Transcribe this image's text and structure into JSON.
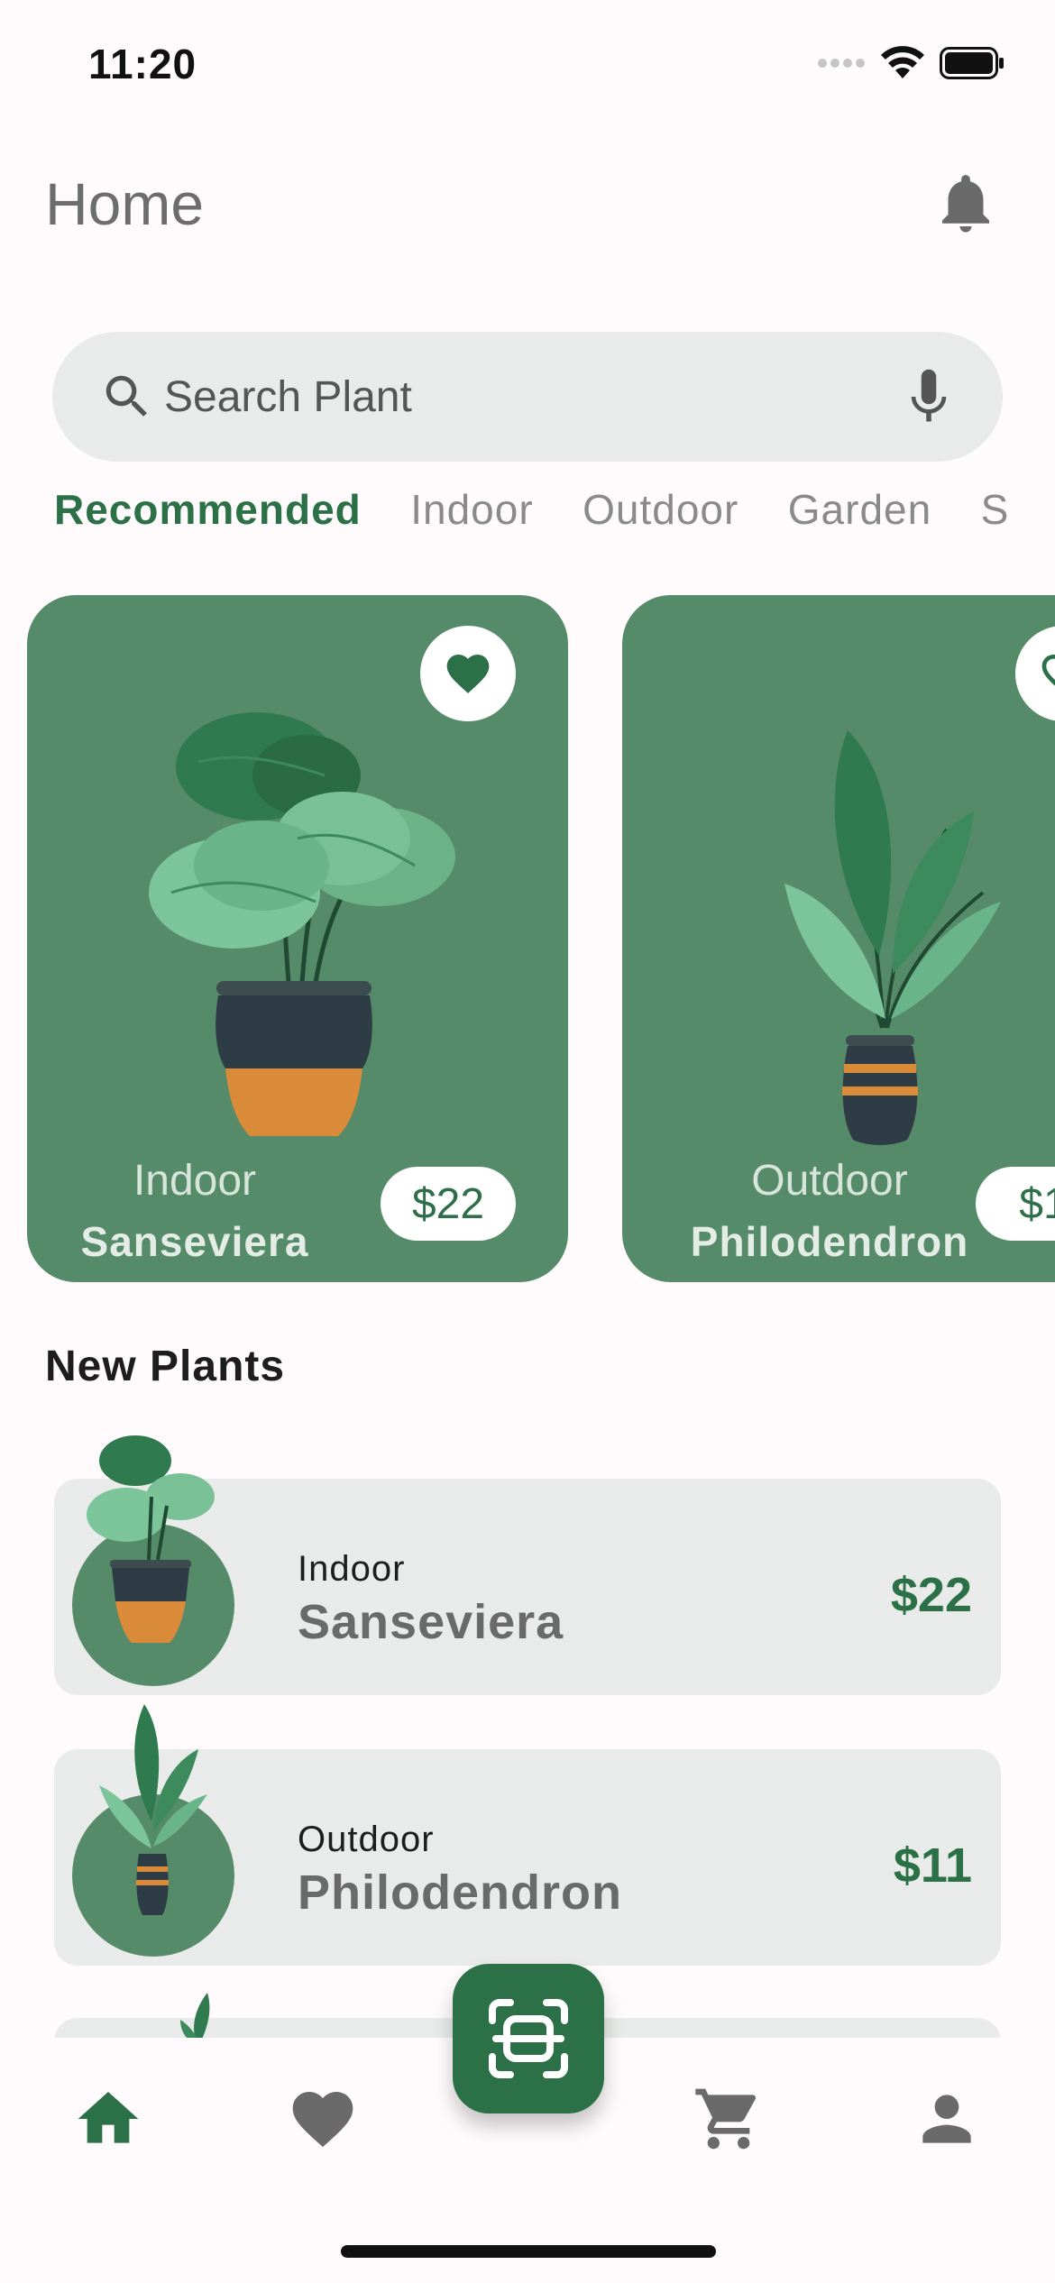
{
  "status_bar": {
    "time": "11:20"
  },
  "header": {
    "title": "Home"
  },
  "search": {
    "placeholder": "Search Plant"
  },
  "tabs": [
    {
      "label": "Recommended",
      "active": true
    },
    {
      "label": "Indoor",
      "active": false
    },
    {
      "label": "Outdoor",
      "active": false
    },
    {
      "label": "Garden",
      "active": false
    },
    {
      "label": "S",
      "active": false
    }
  ],
  "recommended": [
    {
      "category": "Indoor",
      "name": "Sanseviera",
      "price": "$22",
      "favorite": true
    },
    {
      "category": "Outdoor",
      "name": "Philodendron",
      "price": "$1",
      "favorite": false
    }
  ],
  "new_plants": {
    "title": "New Plants",
    "items": [
      {
        "category": "Indoor",
        "name": "Sanseviera",
        "price": "$22"
      },
      {
        "category": "Outdoor",
        "name": "Philodendron",
        "price": "$11"
      }
    ]
  },
  "nav": {
    "active": "home-icon"
  },
  "colors": {
    "accent": "#2b7047",
    "card": "#568b69",
    "list_bg": "#e8ebe9",
    "background": "#fffbfd"
  }
}
